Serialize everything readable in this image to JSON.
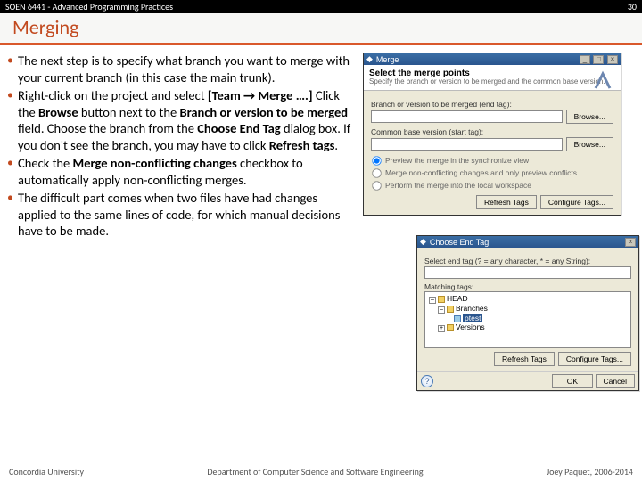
{
  "header": {
    "course": "SOEN 6441 - Advanced Programming Practices",
    "slide_no": "30"
  },
  "title": "Merging",
  "bullets": [
    {
      "pre": "The next step is to specify what branch you want to merge with your current branch (in this case the main trunk)."
    },
    {
      "pre": "Right-click on the project and select ",
      "b1": "[Team ",
      "arrow": "→",
      "b1b": " Merge ….]",
      "mid": " Click the ",
      "b2": "Browse",
      "mid2": " button next to the ",
      "b3": "Branch or version to be merged",
      "mid3": " field. Choose the branch from the ",
      "b4": "Choose End Tag",
      "mid4": " dialog box. If you don't see the branch, you may have to click ",
      "b5": "Refresh tags",
      "post": "."
    },
    {
      "pre": "Check the ",
      "b1": "Merge non-conflicting changes",
      "post": " checkbox to automatically apply non-conflicting merges."
    },
    {
      "pre": "The difficult part comes when two files have had changes applied to the same lines of code, for which manual decisions have to be made."
    }
  ],
  "dlg1": {
    "title": "Merge",
    "banner_title": "Select the merge points",
    "banner_desc": "Specify the branch or version to be merged and the common base version.",
    "f1_label": "Branch or version to be merged (end tag):",
    "f2_label": "Common base version (start tag):",
    "browse": "Browse...",
    "opt1": "Preview the merge in the synchronize view",
    "opt2": "Merge non-conflicting changes and only preview conflicts",
    "opt3": "Perform the merge into the local workspace",
    "refresh": "Refresh Tags",
    "configure": "Configure Tags..."
  },
  "dlg2": {
    "title": "Choose End Tag",
    "banner_title": "Select end tag (? = any character, * = any String):",
    "matching": "Matching tags:",
    "tree": {
      "head": "HEAD",
      "branches": "Branches",
      "sel": "ptest",
      "versions": "Versions"
    },
    "refresh": "Refresh Tags",
    "configure": "Configure Tags...",
    "ok": "OK",
    "cancel": "Cancel"
  },
  "footer": {
    "left": "Concordia University",
    "center": "Department of Computer Science and Software Engineering",
    "right": "Joey Paquet, 2006-2014"
  }
}
